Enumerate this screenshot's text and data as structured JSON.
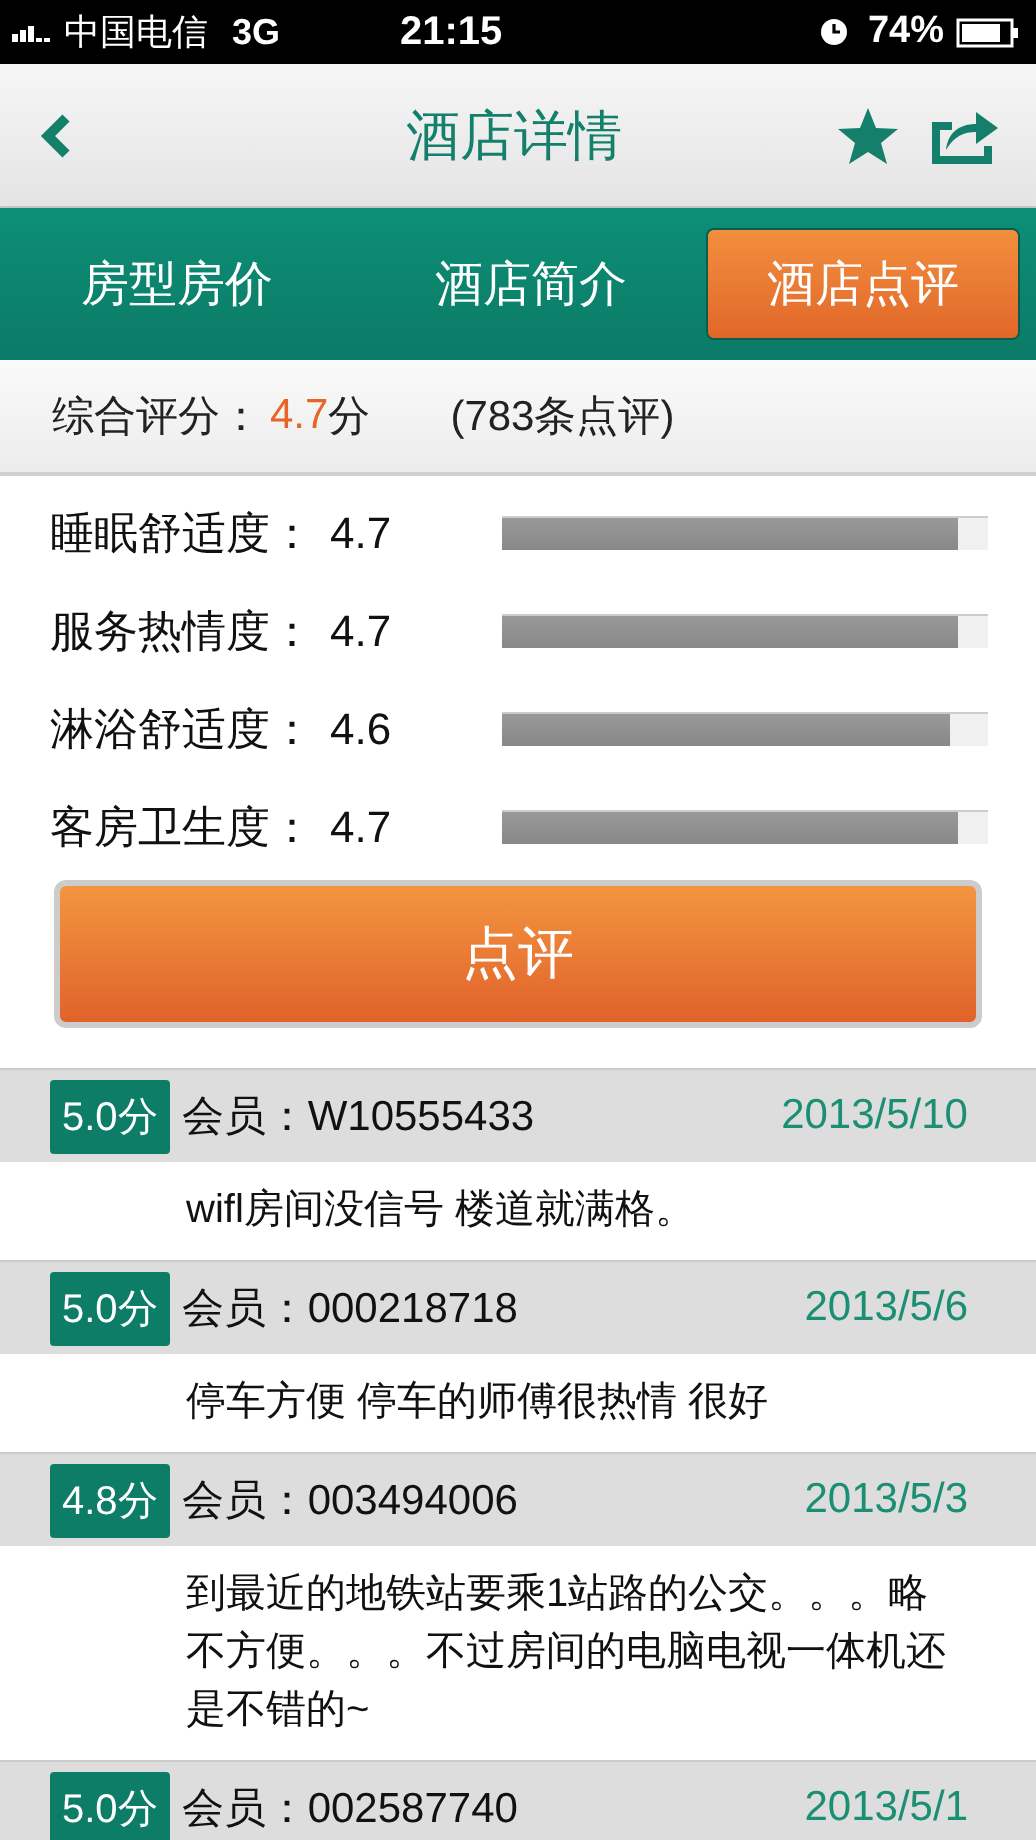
{
  "status_bar": {
    "carrier": "中国电信",
    "network": "3G",
    "time": "21:15",
    "battery": "74%"
  },
  "nav": {
    "title": "酒店详情"
  },
  "tabs": [
    {
      "label": "房型房价",
      "selected": false
    },
    {
      "label": "酒店简介",
      "selected": false
    },
    {
      "label": "酒店点评",
      "selected": true
    }
  ],
  "summary": {
    "label": "综合评分：",
    "score": "4.7",
    "unit": "分",
    "count": "(783条点评)"
  },
  "ratings": [
    {
      "name": "睡眠舒适度：",
      "value": "4.7",
      "level": 0.94
    },
    {
      "name": "服务热情度：",
      "value": "4.7",
      "level": 0.94
    },
    {
      "name": "淋浴舒适度：",
      "value": "4.6",
      "level": 0.92
    },
    {
      "name": "客房卫生度：",
      "value": "4.7",
      "level": 0.94
    }
  ],
  "review_button": "点评",
  "reviews": [
    {
      "score": "5.0分",
      "member": "会员：W10555433",
      "date": "2013/5/10",
      "text": "wifl房间没信号 楼道就满格。"
    },
    {
      "score": "5.0分",
      "member": "会员：000218718",
      "date": "2013/5/6",
      "text": "停车方便 停车的师傅很热情 很好"
    },
    {
      "score": "4.8分",
      "member": "会员：003494006",
      "date": "2013/5/3",
      "text": "到最近的地铁站要乘1站路的公交。。。略不方便。。。不过房间的电脑电视一体机还是不错的~"
    },
    {
      "score": "5.0分",
      "member": "会员：002587740",
      "date": "2013/5/1"
    }
  ]
}
